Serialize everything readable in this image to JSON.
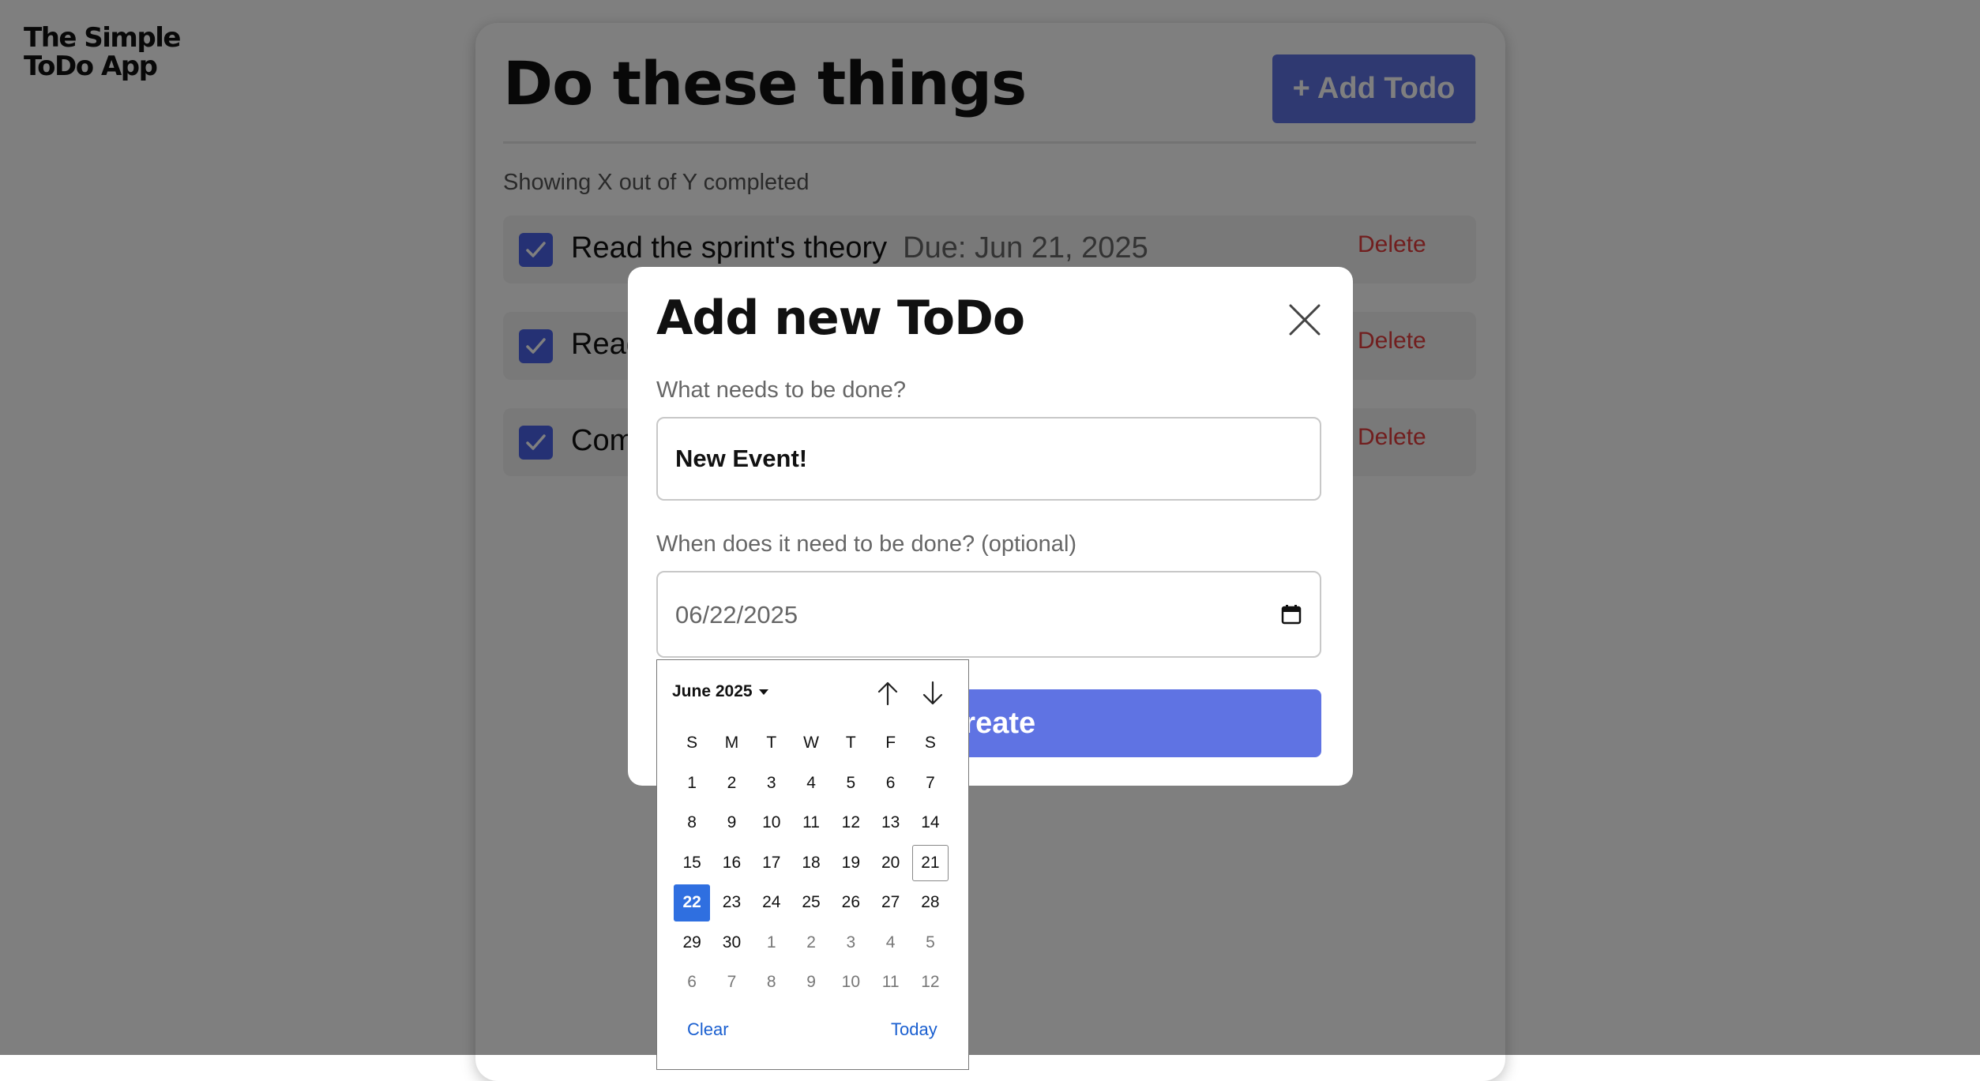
{
  "app": {
    "logo_line1": "The Simple",
    "logo_line2": "ToDo App"
  },
  "main": {
    "title": "Do these things",
    "add_button": "+ Add Todo",
    "summary": "Showing X out of Y completed",
    "todos": [
      {
        "text": "Read the sprint's theory",
        "due": "Due: Jun 21, 2025",
        "delete": "Delete",
        "checked": true
      },
      {
        "text": "Read",
        "due": "",
        "delete": "Delete",
        "checked": true
      },
      {
        "text": "Com",
        "due": "",
        "delete": "Delete",
        "checked": true
      }
    ]
  },
  "modal": {
    "title": "Add new ToDo",
    "task_label": "What needs to be done?",
    "task_value": "New Event!",
    "date_label": "When does it need to be done? (optional)",
    "date_value": "06/22/2025",
    "create_button": "Create"
  },
  "datepicker": {
    "month": "June 2025",
    "weekdays": [
      "S",
      "M",
      "T",
      "W",
      "T",
      "F",
      "S"
    ],
    "days": [
      {
        "d": "1"
      },
      {
        "d": "2"
      },
      {
        "d": "3"
      },
      {
        "d": "4"
      },
      {
        "d": "5"
      },
      {
        "d": "6"
      },
      {
        "d": "7"
      },
      {
        "d": "8"
      },
      {
        "d": "9"
      },
      {
        "d": "10"
      },
      {
        "d": "11"
      },
      {
        "d": "12"
      },
      {
        "d": "13"
      },
      {
        "d": "14"
      },
      {
        "d": "15"
      },
      {
        "d": "16"
      },
      {
        "d": "17"
      },
      {
        "d": "18"
      },
      {
        "d": "19"
      },
      {
        "d": "20"
      },
      {
        "d": "21",
        "state": "today"
      },
      {
        "d": "22",
        "state": "selected"
      },
      {
        "d": "23"
      },
      {
        "d": "24"
      },
      {
        "d": "25"
      },
      {
        "d": "26"
      },
      {
        "d": "27"
      },
      {
        "d": "28"
      },
      {
        "d": "29"
      },
      {
        "d": "30"
      },
      {
        "d": "1",
        "state": "muted"
      },
      {
        "d": "2",
        "state": "muted"
      },
      {
        "d": "3",
        "state": "muted"
      },
      {
        "d": "4",
        "state": "muted"
      },
      {
        "d": "5",
        "state": "muted"
      },
      {
        "d": "6",
        "state": "muted"
      },
      {
        "d": "7",
        "state": "muted"
      },
      {
        "d": "8",
        "state": "muted"
      },
      {
        "d": "9",
        "state": "muted"
      },
      {
        "d": "10",
        "state": "muted"
      },
      {
        "d": "11",
        "state": "muted"
      },
      {
        "d": "12",
        "state": "muted"
      }
    ],
    "clear": "Clear",
    "today": "Today"
  },
  "colors": {
    "accent": "#5f73e3",
    "checkbox": "#4a63e8",
    "delete": "#e23c3c",
    "selected_day": "#2f6fe0",
    "link": "#1a5fd0"
  },
  "icons": {
    "close": "close-icon",
    "calendar": "calendar-icon",
    "checkmark": "checkmark-icon",
    "prev_month": "arrow-up-icon",
    "next_month": "arrow-down-icon",
    "dropdown": "caret-down-icon"
  }
}
